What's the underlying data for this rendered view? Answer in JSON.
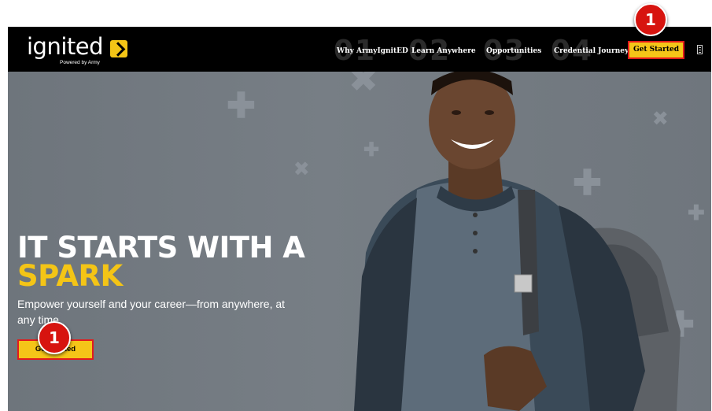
{
  "header": {
    "logo_text": "ignited",
    "logo_subtext": "Powered by Army",
    "nav_items": [
      {
        "number": "01",
        "label": "Why ArmyIgnitED"
      },
      {
        "number": "02",
        "label": "Learn Anywhere"
      },
      {
        "number": "03",
        "label": "Opportunities"
      },
      {
        "number": "04",
        "label": "Credential Journey"
      }
    ],
    "cta_label": "Get Started"
  },
  "hero": {
    "title_line1": "IT STARTS WITH A",
    "title_line2": "SPARK",
    "subtitle": "Empower yourself and your career—from anywhere, at any time.",
    "cta_label": "Get Started"
  },
  "annotations": [
    {
      "label": "1"
    },
    {
      "label": "1"
    }
  ],
  "colors": {
    "accent": "#f5c518",
    "highlight_border": "#e31b1b",
    "badge": "#d7140f",
    "navbar": "#000000"
  }
}
